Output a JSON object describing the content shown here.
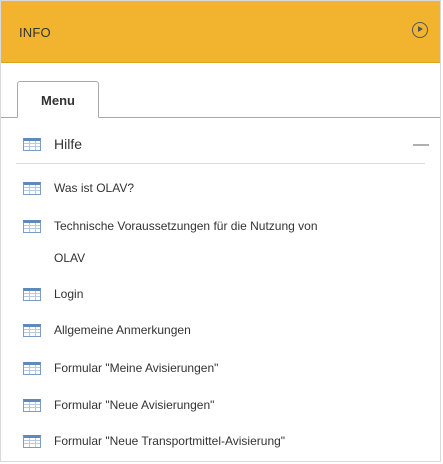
{
  "header": {
    "title": "INFO",
    "toggle_icon": "circle-play-icon",
    "color": "#f2b42e"
  },
  "tabs": [
    {
      "label": "Menu",
      "active": true
    }
  ],
  "section": {
    "label": "Hilfe",
    "icon": "table-icon",
    "collapse_icon": "minus-icon"
  },
  "items": [
    {
      "label": "Was ist OLAV?",
      "icon": "table-icon"
    },
    {
      "label": "Technische Voraussetzungen für die Nutzung von",
      "label_cont": "OLAV",
      "icon": "table-icon"
    },
    {
      "label": "Login",
      "icon": "table-icon"
    },
    {
      "label": "Allgemeine Anmerkungen",
      "icon": "table-icon"
    },
    {
      "label": "Formular \"Meine Avisierungen\"",
      "icon": "table-icon"
    },
    {
      "label": "Formular \"Neue Avisierungen\"",
      "icon": "table-icon"
    },
    {
      "label": "Formular \"Neue Transportmittel-Avisierung\"",
      "icon": "table-icon"
    }
  ]
}
